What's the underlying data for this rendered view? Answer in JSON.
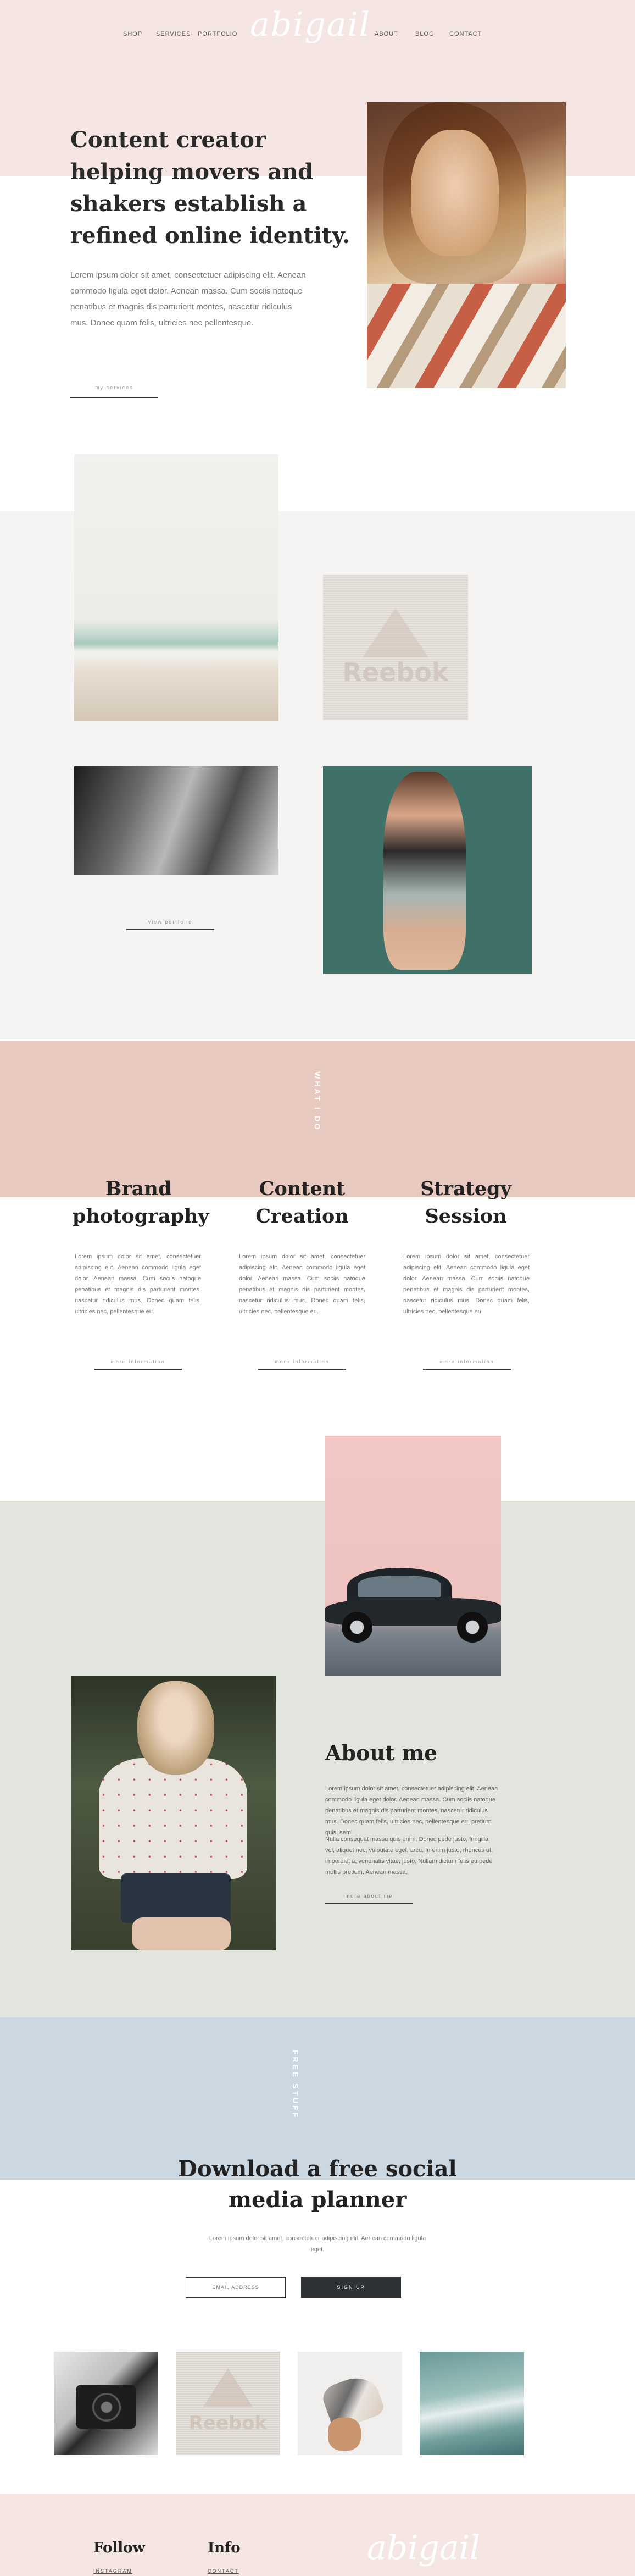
{
  "nav": {
    "left": [
      "SHOP",
      "SERVICES",
      "PORTFOLIO"
    ],
    "right": [
      "ABOUT",
      "BLOG",
      "CONTACT"
    ],
    "logo": "abigail"
  },
  "hero": {
    "title": "Content creator helping movers and shakers establish a refined online identity.",
    "body": "Lorem ipsum dolor sit amet, consectetuer adipiscing elit. Aenean commodo ligula eget dolor. Aenean massa. Cum sociis natoque penatibus et magnis dis parturient montes, nascetur ridiculus mus. Donec quam felis, ultricies nec pellentesque.",
    "button": "my services"
  },
  "portfolio": {
    "button": "view portfolio",
    "reebok_text": "Reebok"
  },
  "what_i_do": {
    "label": "WHAT I DO",
    "services": [
      {
        "title": "Brand photography",
        "body": "Lorem ipsum dolor sit amet, consectetuer adipiscing elit. Aenean commodo ligula eget dolor. Aenean massa. Cum sociis natoque penatibus et magnis dis parturient montes, nascetur ridiculus mus. Donec quam felis, ultricies nec, pellentesque eu.",
        "button": "more information"
      },
      {
        "title": "Content Creation",
        "body": "Lorem ipsum dolor sit amet, consectetuer adipiscing elit. Aenean commodo ligula eget dolor. Aenean massa. Cum sociis natoque penatibus et magnis dis parturient montes, nascetur ridiculus mus. Donec quam felis, ultricies nec, pellentesque eu.",
        "button": "more information"
      },
      {
        "title": "Strategy Session",
        "body": "Lorem ipsum dolor sit amet, consectetuer adipiscing elit. Aenean commodo ligula eget dolor. Aenean massa. Cum sociis natoque penatibus et magnis dis parturient montes, nascetur ridiculus mus. Donec quam felis, ultricies nec, pellentesque eu.",
        "button": "more information"
      }
    ]
  },
  "about": {
    "title": "About me",
    "body1": "Lorem ipsum dolor sit amet, consectetuer adipiscing elit. Aenean commodo ligula eget dolor. Aenean massa. Cum sociis natoque penatibus et magnis dis parturient montes, nascetur ridiculus mus. Donec quam felis, ultricies nec, pellentesque eu, pretium quis, sem.",
    "body2": "Nulla consequat massa quis enim. Donec pede justo, fringilla vel, aliquet nec, vulputate eget, arcu. In enim justo, rhoncus ut, imperdiet a, venenatis vitae, justo. Nullam dictum felis eu pede mollis pretium. Aenean massa.",
    "button": "more about me"
  },
  "free_stuff": {
    "label": "FREE STUFF",
    "title": "Download a free social media planner",
    "body": "Lorem ipsum dolor sit amet, consectetuer adipiscing elit. Aenean commodo ligula eget.",
    "email_placeholder": "EMAIL ADDRESS",
    "signup": "SIGN UP"
  },
  "footer": {
    "follow": "Follow",
    "follow_sub": "INSTAGRAM",
    "info": "Info",
    "info_sub": "CONTACT",
    "logo": "abigail"
  }
}
